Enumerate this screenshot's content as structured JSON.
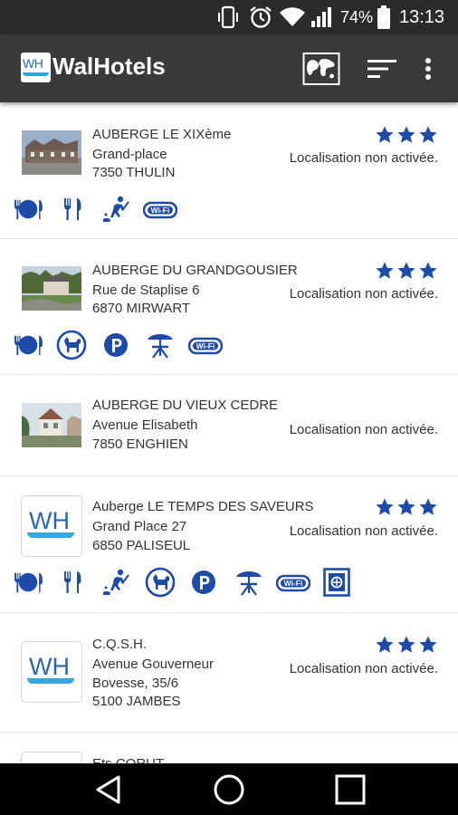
{
  "status_bar": {
    "battery": "74%",
    "time": "13:13",
    "icons": [
      "vibrate-icon",
      "alarm-icon",
      "wifi-icon",
      "signal-icon",
      "battery-icon"
    ]
  },
  "app_bar": {
    "logo_text": "WH",
    "title": "WalHotels",
    "actions": [
      "map-icon",
      "sort-icon",
      "more-vert-icon"
    ]
  },
  "hotels": [
    {
      "name": "AUBERGE LE XIXème",
      "address": [
        "Grand-place",
        "7350 THULIN"
      ],
      "location": "Localisation non activée.",
      "stars": 3,
      "thumb": "photo",
      "facilities": [
        "restaurant-icon",
        "cutlery-icon",
        "golf-icon",
        "wifi-badge-icon"
      ]
    },
    {
      "name": "AUBERGE DU GRANDGOUSIER",
      "address": [
        "Rue de Staplise 6",
        "6870 MIRWART"
      ],
      "location": "Localisation non activée.",
      "stars": 3,
      "thumb": "photo",
      "facilities": [
        "restaurant-icon",
        "pets-icon",
        "parking-icon",
        "terrace-icon",
        "wifi-badge-icon"
      ]
    },
    {
      "name": "AUBERGE DU VIEUX CEDRE",
      "address": [
        "Avenue Elisabeth",
        "7850 ENGHIEN"
      ],
      "location": "Localisation non activée.",
      "stars": 0,
      "thumb": "photo",
      "facilities": []
    },
    {
      "name": "Auberge LE TEMPS DES SAVEURS",
      "address": [
        "Grand Place 27",
        "6850 PALISEUL"
      ],
      "location": "Localisation non activée.",
      "stars": 3,
      "thumb": "wh-logo",
      "thumb_text": "WH",
      "facilities": [
        "restaurant-icon",
        "cutlery-icon",
        "golf-icon",
        "pets-icon",
        "parking-icon",
        "terrace-icon",
        "wifi-badge-icon",
        "safe-icon"
      ]
    },
    {
      "name": "C.Q.S.H.",
      "address": [
        "Avenue Gouverneur",
        "Bovesse, 35/6",
        "5100 JAMBES"
      ],
      "location": "Localisation non activée.",
      "stars": 3,
      "thumb": "wh-logo",
      "thumb_text": "WH",
      "facilities": []
    },
    {
      "name": "Ets CORUT",
      "address": [],
      "location": "",
      "stars": 0,
      "thumb": "wh-logo",
      "facilities": []
    }
  ],
  "colors": {
    "accent": "#1e4aa8",
    "app_bar": "#3a3a3a",
    "status_bar": "#2b2b2b",
    "nav_bar": "#000000"
  },
  "nav_bar": [
    "back-icon",
    "home-icon",
    "recents-icon"
  ]
}
